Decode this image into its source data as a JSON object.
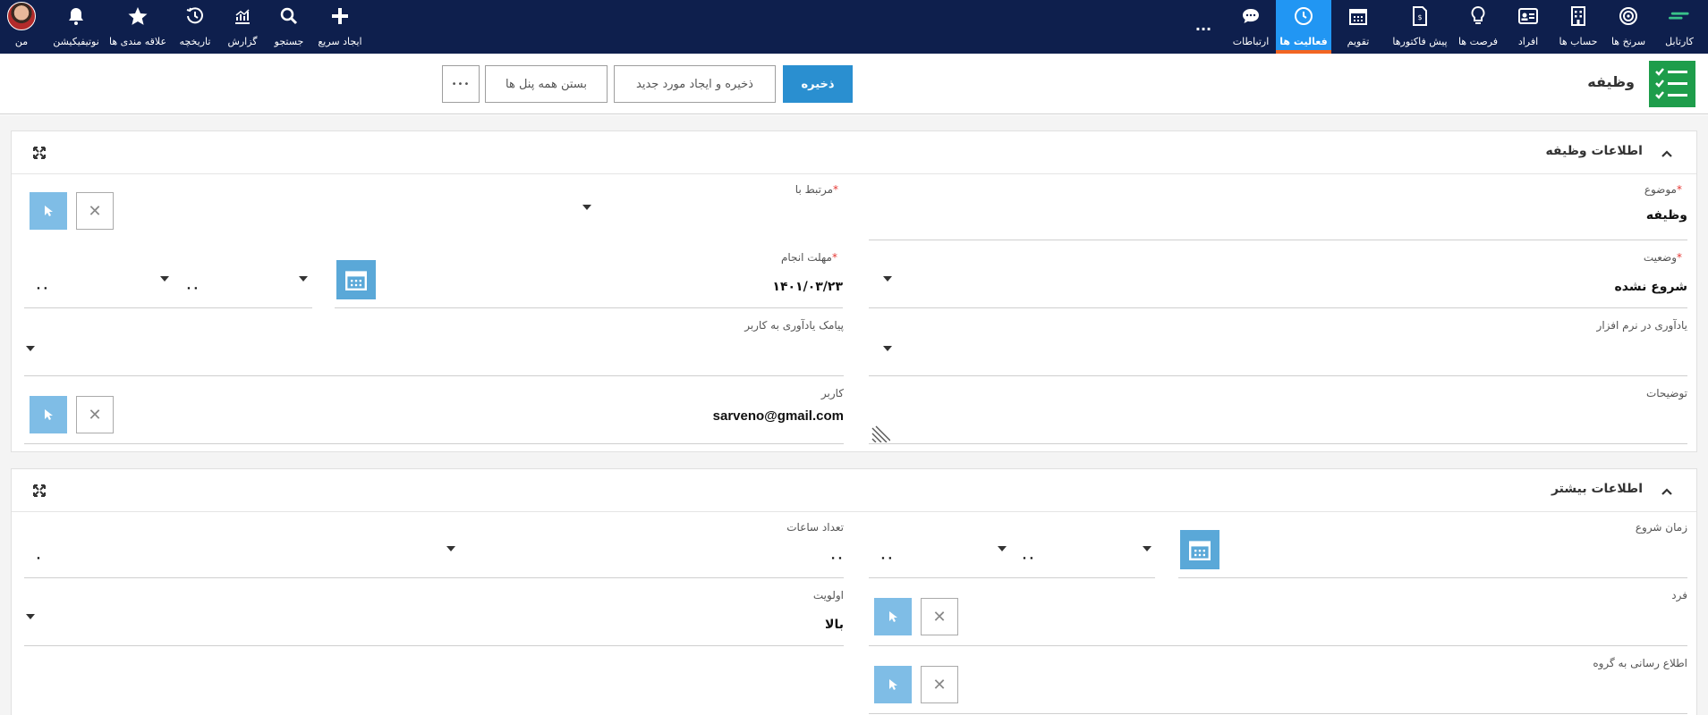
{
  "nav": {
    "right": [
      {
        "label": "کارتابل",
        "icon": "dashboard-icon"
      },
      {
        "label": "سرنخ ها",
        "icon": "target-icon"
      },
      {
        "label": "حساب ها",
        "icon": "building-icon"
      },
      {
        "label": "افراد",
        "icon": "id-card-icon"
      },
      {
        "label": "فرصت ها",
        "icon": "lightbulb-icon"
      },
      {
        "label": "پیش فاکتورها",
        "icon": "invoice-icon"
      },
      {
        "label": "تقویم",
        "icon": "calendar-icon"
      },
      {
        "label": "فعالیت ها",
        "icon": "clock-icon"
      },
      {
        "label": "ارتباطات",
        "icon": "chat-icon"
      }
    ],
    "more": "...",
    "left": [
      {
        "label": "ایجاد سریع",
        "icon": "plus-icon"
      },
      {
        "label": "جستجو",
        "icon": "search-icon"
      },
      {
        "label": "گزارش",
        "icon": "chart-icon"
      },
      {
        "label": "تاریخچه",
        "icon": "history-icon"
      },
      {
        "label": "علاقه مندی ها",
        "icon": "star-icon"
      },
      {
        "label": "نوتیفیکیشن",
        "icon": "bell-icon"
      },
      {
        "label": "من",
        "icon": "avatar"
      }
    ]
  },
  "header": {
    "title": "وظیفه",
    "save": "ذخیره",
    "save_new": "ذخیره و ایجاد مورد جدید",
    "close_panels": "بستن همه پنل ها",
    "more": "•••"
  },
  "panel1": {
    "title": "اطلاعات وظیفه",
    "subject_label": "موضوع",
    "subject_value": "وظیفه",
    "related_label": "مرتبط با",
    "status_label": "وضعیت",
    "status_value": "شروع نشده",
    "due_label": "مهلت انجام",
    "due_value": "۱۴۰۱/۰۳/۲۳",
    "due_hour": "۰۰",
    "due_min": "۰۰",
    "reminder_app_label": "یادآوری در نرم افزار",
    "reminder_sms_label": "پیامک یادآوری به کاربر",
    "description_label": "توضیحات",
    "user_label": "کاربر",
    "user_value": "sarveno@gmail.com",
    "req": "*"
  },
  "panel2": {
    "title": "اطلاعات بیشتر",
    "start_label": "زمان شروع",
    "start_hour": "۰۰",
    "start_min": "۰۰",
    "hours_label": "تعداد ساعات",
    "hours_value": "۰۰",
    "hours_min": "۰",
    "person_label": "فرد",
    "priority_label": "اولویت",
    "priority_value": "بالا",
    "notify_group_label": "اطلاع رسانی به گروه"
  }
}
